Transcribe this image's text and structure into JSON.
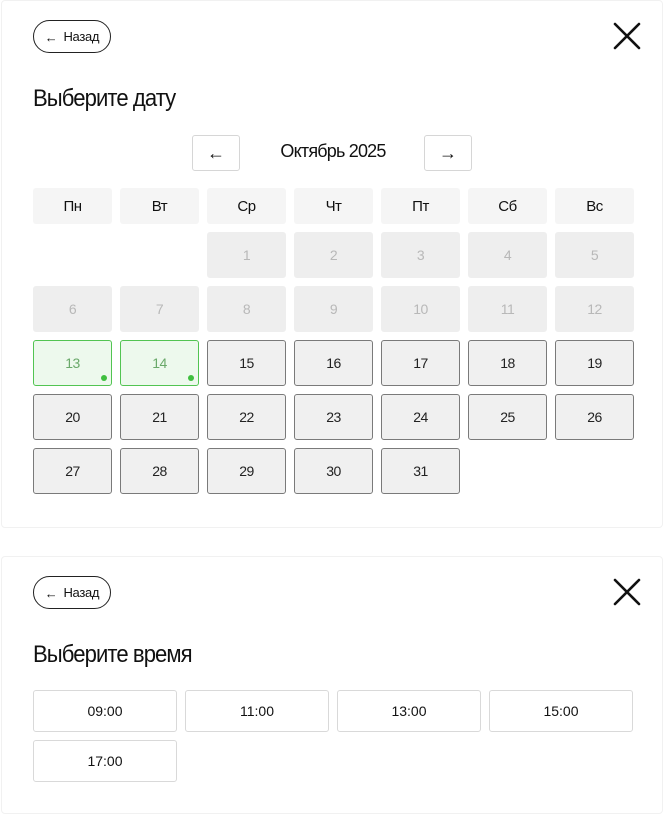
{
  "date_step": {
    "back_label": "Назад",
    "title": "Выберите дату",
    "month_label": "Октябрь 2025",
    "prev_icon": "←",
    "next_icon": "→",
    "weekdays": [
      "Пн",
      "Вт",
      "Ср",
      "Чт",
      "Пт",
      "Сб",
      "Вс"
    ],
    "leading_empty": 2,
    "days": [
      {
        "label": "1",
        "state": "disabled"
      },
      {
        "label": "2",
        "state": "disabled"
      },
      {
        "label": "3",
        "state": "disabled"
      },
      {
        "label": "4",
        "state": "disabled"
      },
      {
        "label": "5",
        "state": "disabled"
      },
      {
        "label": "6",
        "state": "disabled"
      },
      {
        "label": "7",
        "state": "disabled"
      },
      {
        "label": "8",
        "state": "disabled"
      },
      {
        "label": "9",
        "state": "disabled"
      },
      {
        "label": "10",
        "state": "disabled"
      },
      {
        "label": "11",
        "state": "disabled"
      },
      {
        "label": "12",
        "state": "disabled"
      },
      {
        "label": "13",
        "state": "available"
      },
      {
        "label": "14",
        "state": "available"
      },
      {
        "label": "15",
        "state": "active"
      },
      {
        "label": "16",
        "state": "active"
      },
      {
        "label": "17",
        "state": "active"
      },
      {
        "label": "18",
        "state": "active"
      },
      {
        "label": "19",
        "state": "active"
      },
      {
        "label": "20",
        "state": "active"
      },
      {
        "label": "21",
        "state": "active"
      },
      {
        "label": "22",
        "state": "active"
      },
      {
        "label": "23",
        "state": "active"
      },
      {
        "label": "24",
        "state": "active"
      },
      {
        "label": "25",
        "state": "active"
      },
      {
        "label": "26",
        "state": "active"
      },
      {
        "label": "27",
        "state": "active"
      },
      {
        "label": "28",
        "state": "active"
      },
      {
        "label": "29",
        "state": "active"
      },
      {
        "label": "30",
        "state": "active"
      },
      {
        "label": "31",
        "state": "active"
      }
    ]
  },
  "time_step": {
    "back_label": "Назад",
    "title": "Выберите время",
    "slots": [
      "09:00",
      "11:00",
      "13:00",
      "15:00",
      "17:00"
    ]
  },
  "colors": {
    "available_border": "#52c452",
    "available_bg": "#edf9ed",
    "available_dot": "#3fbf3f",
    "disabled_bg": "#eeeeee"
  }
}
